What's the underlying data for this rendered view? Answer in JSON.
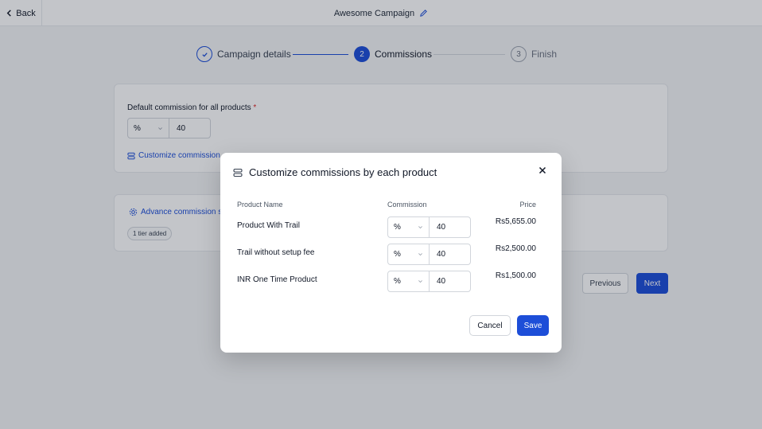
{
  "topbar": {
    "back_label": "Back",
    "campaign_title": "Awesome Campaign"
  },
  "stepper": {
    "steps": [
      {
        "number": "",
        "label": "Campaign details",
        "state": "done"
      },
      {
        "number": "2",
        "label": "Commissions",
        "state": "active"
      },
      {
        "number": "3",
        "label": "Finish",
        "state": "pending"
      }
    ]
  },
  "default_card": {
    "label": "Default commission for all products",
    "required_mark": "*",
    "unit": "%",
    "value": "40",
    "customize_link": "Customize commission"
  },
  "advance_card": {
    "link": "Advance commission s",
    "badge": "1 tier added"
  },
  "nav": {
    "previous": "Previous",
    "next": "Next"
  },
  "modal": {
    "title": "Customize commissions by each product",
    "columns": {
      "name": "Product Name",
      "commission": "Commission",
      "price": "Price"
    },
    "rows": [
      {
        "name": "Product With Trail",
        "unit": "%",
        "value": "40",
        "price": "Rs5,655.00"
      },
      {
        "name": "Trail without setup fee",
        "unit": "%",
        "value": "40",
        "price": "Rs2,500.00"
      },
      {
        "name": "INR One Time Product",
        "unit": "%",
        "value": "40",
        "price": "Rs1,500.00"
      }
    ],
    "cancel": "Cancel",
    "save": "Save"
  },
  "colors": {
    "accent": "#1d4ed8",
    "required": "#dc2626",
    "overlay": "rgba(17,24,39,0.25)"
  },
  "icons": [
    "chevron-left-icon",
    "pencil-icon",
    "check-icon",
    "sliders-icon",
    "gear-icon",
    "close-icon",
    "chevron-down-icon"
  ]
}
